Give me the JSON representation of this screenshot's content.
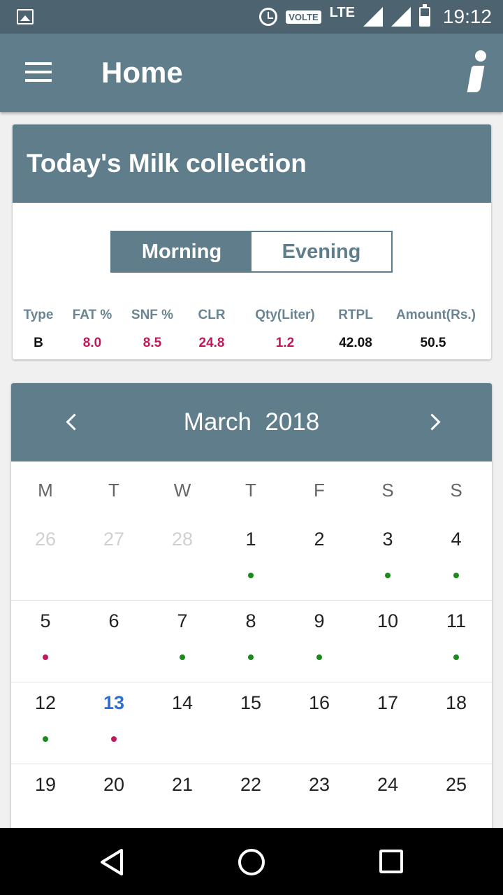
{
  "status_bar": {
    "volte": "VOLTE",
    "network": "LTE",
    "time": "19:12"
  },
  "app_bar": {
    "title": "Home"
  },
  "collection_card": {
    "title": "Today's Milk collection",
    "shifts": [
      "Morning",
      "Evening"
    ],
    "selected_shift": "Morning",
    "columns": [
      "Type",
      "FAT %",
      "SNF %",
      "CLR",
      "Qty(Liter)",
      "RTPL",
      "Amount(Rs.)"
    ],
    "row": [
      "B",
      "8.0",
      "8.5",
      "24.8",
      "1.2",
      "42.08",
      "50.5"
    ]
  },
  "calendar": {
    "month": "March",
    "year": "2018",
    "title": "March  2018",
    "weekdays": [
      "M",
      "T",
      "W",
      "T",
      "F",
      "S",
      "S"
    ],
    "weeks": [
      [
        "26",
        "27",
        "28",
        "1",
        "2",
        "3",
        "4"
      ],
      [
        "5",
        "6",
        "7",
        "8",
        "9",
        "10",
        "11"
      ],
      [
        "12",
        "13",
        "14",
        "15",
        "16",
        "17",
        "18"
      ],
      [
        "19",
        "20",
        "21",
        "22",
        "23",
        "24",
        "25"
      ]
    ],
    "today": "13",
    "dot_colors": {
      "green": "#1a8a1a",
      "red": "#c2185b"
    }
  }
}
